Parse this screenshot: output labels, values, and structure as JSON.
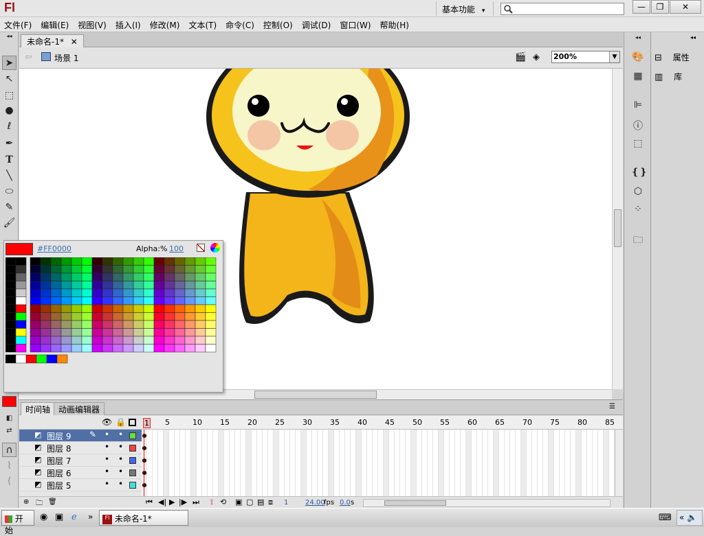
{
  "app": {
    "logo": "Fl",
    "workspace": "基本功能",
    "window_min": "—",
    "window_restore": "❐",
    "window_close": "✕"
  },
  "menubar": [
    "文件(F)",
    "编辑(E)",
    "视图(V)",
    "插入(I)",
    "修改(M)",
    "文本(T)",
    "命令(C)",
    "控制(O)",
    "调试(D)",
    "窗口(W)",
    "帮助(H)"
  ],
  "document": {
    "tab_label": "未命名-1*",
    "scene_label": "场景 1",
    "zoom": "200%"
  },
  "swatches": {
    "current_hex": "#FF0000",
    "alpha_label": "Alpha:%",
    "alpha_value": "100"
  },
  "right_panel": {
    "properties_label": "属性",
    "library_label": "库"
  },
  "timeline": {
    "tabs": [
      "时间轴",
      "动画编辑器"
    ],
    "frame_ticks": [
      "1",
      "5",
      "10",
      "15",
      "20",
      "25",
      "30",
      "35",
      "40",
      "45",
      "50",
      "55",
      "60",
      "65",
      "70",
      "75",
      "80",
      "85"
    ],
    "layers": [
      {
        "name": "图层 9",
        "color": "#66dd44",
        "selected": true
      },
      {
        "name": "图层 8",
        "color": "#ee4444",
        "selected": false
      },
      {
        "name": "图层 7",
        "color": "#4466ee",
        "selected": false
      },
      {
        "name": "图层 6",
        "color": "#777777",
        "selected": false
      },
      {
        "name": "图层 5",
        "color": "#44dddd",
        "selected": false
      }
    ],
    "status": {
      "frame": "1",
      "fps": "24.00",
      "fps_unit": "fps",
      "time": "0.0",
      "time_unit": "s"
    }
  },
  "taskbar": {
    "start_label": "开始",
    "task_item": "未命名-1*",
    "overflow": "»"
  }
}
